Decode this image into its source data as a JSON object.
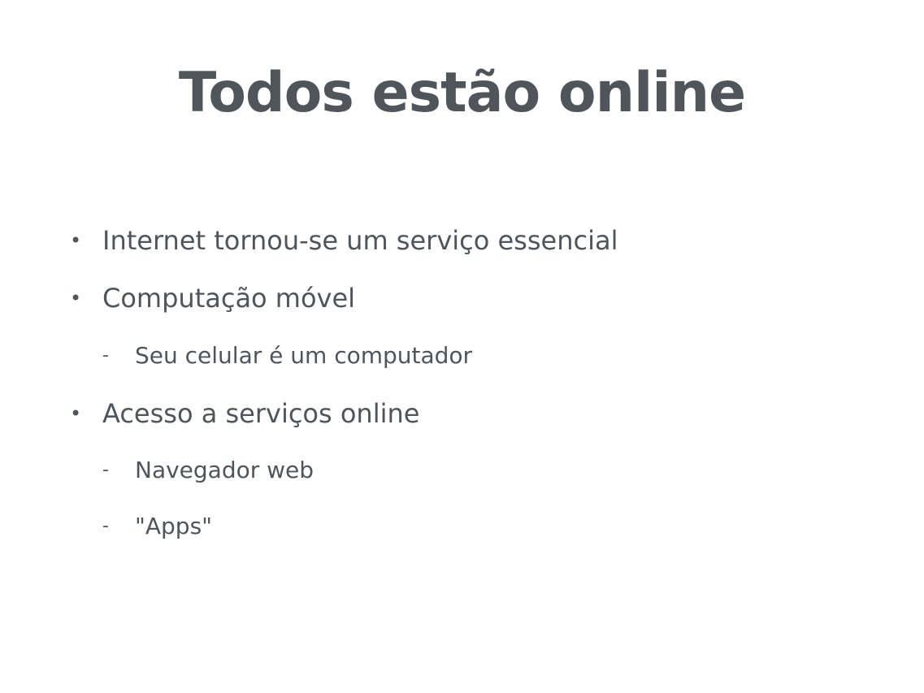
{
  "slide": {
    "title": "Todos estão online",
    "items": [
      {
        "level": 1,
        "marker": "•",
        "text": "Internet tornou-se um serviço essencial"
      },
      {
        "level": 1,
        "marker": "•",
        "text": "Computação móvel"
      },
      {
        "level": 2,
        "marker": "-",
        "text": "Seu celular é um computador"
      },
      {
        "level": 1,
        "marker": "•",
        "text": "Acesso a serviços online"
      },
      {
        "level": 2,
        "marker": "-",
        "text": "Navegador web"
      },
      {
        "level": 2,
        "marker": "-",
        "text": "\"Apps\""
      }
    ]
  },
  "colors": {
    "text": "#50555c",
    "background": "#ffffff"
  }
}
